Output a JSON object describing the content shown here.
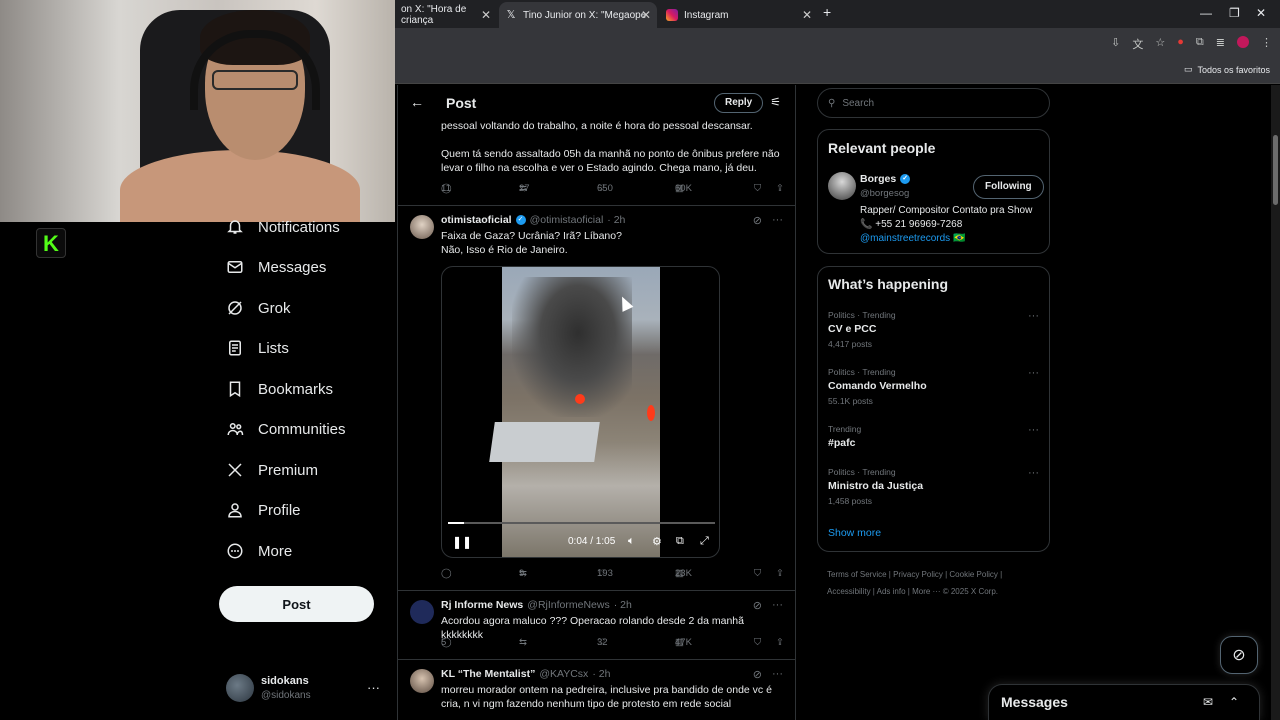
{
  "browser": {
    "tabs": [
      {
        "title": "on X: \"Hora de criança",
        "icon": "x-logo-icon"
      },
      {
        "title": "Tino Junior on X: \"⁠Megaope",
        "icon": "x-logo-icon"
      },
      {
        "title": "Instagram",
        "icon": "instagram-icon"
      }
    ],
    "new_tab": "+",
    "bookmark_folder": "Todos os favoritos"
  },
  "sidebar": {
    "items": [
      {
        "label": "Notifications",
        "icon": "bell-icon"
      },
      {
        "label": "Messages",
        "icon": "envelope-icon"
      },
      {
        "label": "Grok",
        "icon": "grok-icon"
      },
      {
        "label": "Lists",
        "icon": "list-icon"
      },
      {
        "label": "Bookmarks",
        "icon": "bookmark-icon"
      },
      {
        "label": "Communities",
        "icon": "people-icon"
      },
      {
        "label": "Premium",
        "icon": "x-logo-icon"
      },
      {
        "label": "Profile",
        "icon": "person-icon"
      },
      {
        "label": "More",
        "icon": "more-circle-icon"
      }
    ],
    "post_button": "Post",
    "account": {
      "name": "sidokans",
      "handle": "@sidokans"
    }
  },
  "header": {
    "title": "Post",
    "reply_button": "Reply"
  },
  "posts": [
    {
      "text1": "pessoal voltando do trabalho, a noite é hora do pessoal descansar.",
      "text2": "Quem tá sendo assaltado 05h da manhã no ponto de ônibus prefere não levar o filho na escolha e ver o Estado agindo. Chega mano, já deu.",
      "replies": "11",
      "reposts": "27",
      "likes": "650",
      "views": "60K"
    },
    {
      "name": "otimistaoficial",
      "handle": "@otimistaoficial",
      "time": "· 2h",
      "line1": "Faixa de Gaza? Ucrânia? Irã? Líbano?",
      "line2": "Não, Isso é Rio de Janeiro.",
      "video_time": "0:04 / 1:05",
      "video_progress": 0.06,
      "replies": "",
      "reposts": "9",
      "likes": "193",
      "views": "23K"
    },
    {
      "name": "Rj Informe News",
      "handle": "@RjInformeNews",
      "time": "· 2h",
      "text": "Acordou agora maluco ??? Operacao rolando desde 2 da manhã kkkkkkkk",
      "replies": "5",
      "reposts": "",
      "likes": "32",
      "views": "47K"
    },
    {
      "name": "KL “The Mentalist”",
      "handle": "@KAYCsx",
      "time": "· 2h",
      "text": "morreu morador ontem na pedreira, inclusive pra bandido de onde vc é cria, n vi ngm fazendo nenhum tipo de protesto em rede social"
    }
  ],
  "search": {
    "placeholder": "Search"
  },
  "relevant": {
    "title": "Relevant people",
    "name": "Borges",
    "handle": "@borgesog",
    "button": "Following",
    "bio1": "Rapper/ Compositor Contato pra Show",
    "bio2": "📞 +55 21 96969-7268",
    "bio3": "@mainstreetrecords 🇧🇷"
  },
  "happening": {
    "title": "What’s happening",
    "trends": [
      {
        "meta": "Politics · Trending",
        "name": "CV e PCC",
        "count": "4,417 posts"
      },
      {
        "meta": "Politics · Trending",
        "name": "Comando Vermelho",
        "count": "55.1K posts"
      },
      {
        "meta": "Trending",
        "name": "#pafc",
        "count": ""
      },
      {
        "meta": "Politics · Trending",
        "name": "Ministro da Justiça",
        "count": "1,458 posts"
      }
    ],
    "show_more": "Show more"
  },
  "footer": {
    "line1": "Terms of Service  |  Privacy Policy  |  Cookie Policy  |",
    "line2": "Accessibility  |  Ads info  |  More ···  © 2025 X Corp."
  },
  "messages_dock": {
    "title": "Messages"
  },
  "colors": {
    "accent": "#1d9bf0",
    "bg": "#000000",
    "muted": "#71767b",
    "kick": "#53fc18"
  }
}
